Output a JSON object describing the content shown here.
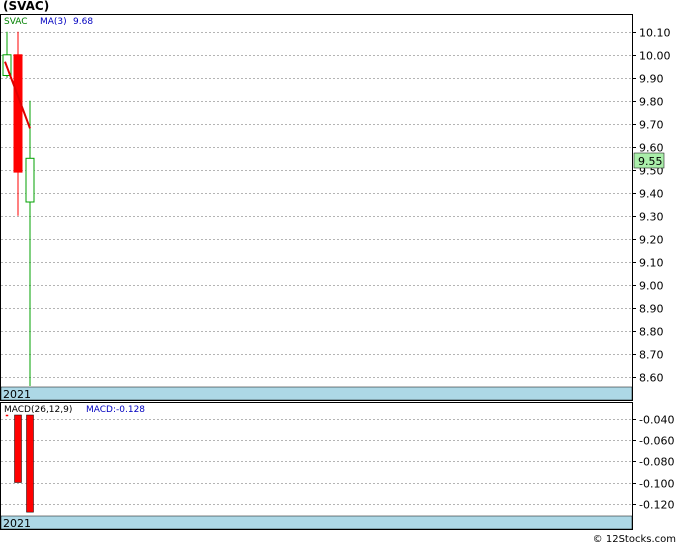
{
  "title": "(SVAC)",
  "watermark": "© 12Stocks.com",
  "colors": {
    "background": "#ffffff",
    "grid": "#b4b4b4",
    "up": "#00a000",
    "down": "#ff0000",
    "ma": "#e00000",
    "yearband": "#add8e6",
    "last_price_box": "#aaeeaa",
    "macd_bar": "#ff0000",
    "label_blue": "#0000c0"
  },
  "chart_data": [
    {
      "type": "candlestick",
      "legend": {
        "symbol": "SVAC",
        "ma_label": "MA(3)",
        "ma_value": "9.68"
      },
      "x_label": "2021",
      "y_ticks": [
        "10.10",
        "10.00",
        "9.90",
        "9.80",
        "9.70",
        "9.60",
        "9.50",
        "9.40",
        "9.30",
        "9.20",
        "9.10",
        "9.00",
        "8.90",
        "8.80",
        "8.70",
        "8.60"
      ],
      "ylim": [
        8.56,
        10.16
      ],
      "last_price": "9.55",
      "candles": [
        {
          "open": 9.91,
          "high": 10.1,
          "low": 9.9,
          "close": 10.0
        },
        {
          "open": 10.0,
          "high": 10.1,
          "low": 9.3,
          "close": 9.49
        },
        {
          "open": 9.36,
          "high": 9.8,
          "low": 8.56,
          "close": 9.55
        }
      ],
      "ma": [
        {
          "index": 0,
          "value": 9.97
        },
        {
          "index": 1,
          "value": 9.82
        },
        {
          "index": 2,
          "value": 9.68
        }
      ]
    },
    {
      "type": "bar",
      "legend": {
        "label": "MACD(26,12,9)",
        "value_label": "MACD:-0.128"
      },
      "x_label": "2021",
      "y_ticks": [
        "-0.040",
        "-0.060",
        "-0.080",
        "-0.100",
        "-0.120"
      ],
      "ylim": [
        -0.1307,
        -0.0315
      ],
      "values": [
        -0.03,
        -0.1,
        -0.128
      ]
    }
  ]
}
